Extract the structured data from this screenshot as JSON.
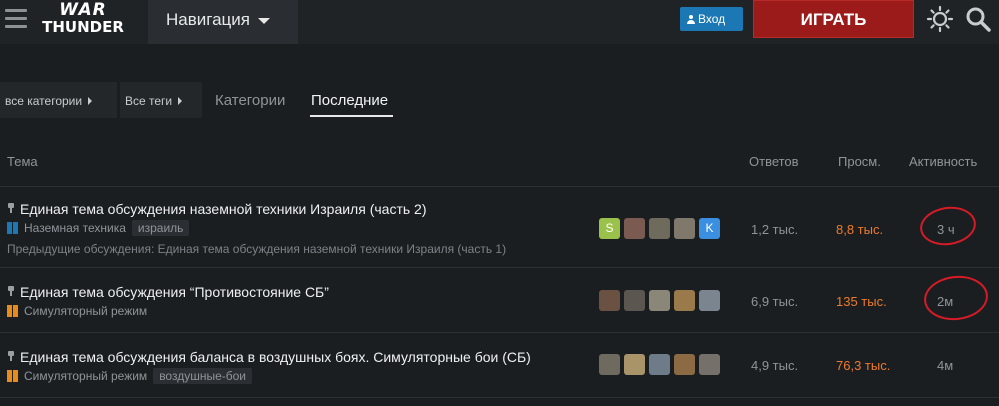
{
  "header": {
    "logo_line1": "WAR",
    "logo_line2": "THUNDER",
    "nav_label": "Навигация",
    "login_label": "Вход",
    "play_label": "ИГРАТЬ",
    "colors": {
      "play": "#9b1b1b",
      "login": "#1c78b4",
      "accent_views": "#ed7a2c"
    }
  },
  "filters": {
    "categories_dropdown": "все категории",
    "tags_dropdown": "Все теги",
    "tab_categories": "Категории",
    "tab_latest": "Последние"
  },
  "table": {
    "columns": {
      "topic": "Тема",
      "replies": "Ответов",
      "views": "Просм.",
      "activity": "Активность"
    },
    "rows": [
      {
        "title": "Единая тема обсуждения наземной техники Израиля (часть 2)",
        "category": "Наземная техника",
        "category_colors": [
          "#1c78b4",
          "#1c78b4"
        ],
        "tags": [
          "израиль"
        ],
        "excerpt": "Предыдущие обсуждения: Единая тема обсуждения наземной техники Израиля (часть 1)",
        "avatars": [
          {
            "letter": "S",
            "color": "#9ac24b"
          },
          {
            "letter": "",
            "color": "#7b5a52"
          },
          {
            "letter": "",
            "color": "#6e6a5c"
          },
          {
            "letter": "",
            "color": "#80796b"
          },
          {
            "letter": "K",
            "color": "#3b8fe0"
          }
        ],
        "replies": "1,2 тыс.",
        "views": "8,8 тыс.",
        "activity": "3 ч"
      },
      {
        "title": "Единая тема обсуждения “Противостояние СБ”",
        "category": "Симуляторный режим",
        "category_colors": [
          "#e98b1b",
          "#e98b1b"
        ],
        "tags": [],
        "excerpt": "",
        "avatars": [
          {
            "letter": "",
            "color": "#6b5142"
          },
          {
            "letter": "",
            "color": "#5c5650"
          },
          {
            "letter": "",
            "color": "#8a8678"
          },
          {
            "letter": "",
            "color": "#9a7a4a"
          },
          {
            "letter": "",
            "color": "#7a8590"
          }
        ],
        "replies": "6,9 тыс.",
        "views": "135 тыс.",
        "activity": "2м"
      },
      {
        "title": "Единая тема обсуждения баланса в воздушных боях. Симуляторные бои (СБ)",
        "category": "Симуляторный режим",
        "category_colors": [
          "#e98b1b",
          "#e98b1b"
        ],
        "tags": [
          "воздушные-бои"
        ],
        "excerpt": "",
        "avatars": [
          {
            "letter": "",
            "color": "#6f6a60"
          },
          {
            "letter": "",
            "color": "#a89468"
          },
          {
            "letter": "",
            "color": "#6e7c8a"
          },
          {
            "letter": "",
            "color": "#8c6a44"
          },
          {
            "letter": "",
            "color": "#76706a"
          }
        ],
        "replies": "4,9 тыс.",
        "views": "76,3 тыс.",
        "activity": "4м"
      }
    ]
  }
}
